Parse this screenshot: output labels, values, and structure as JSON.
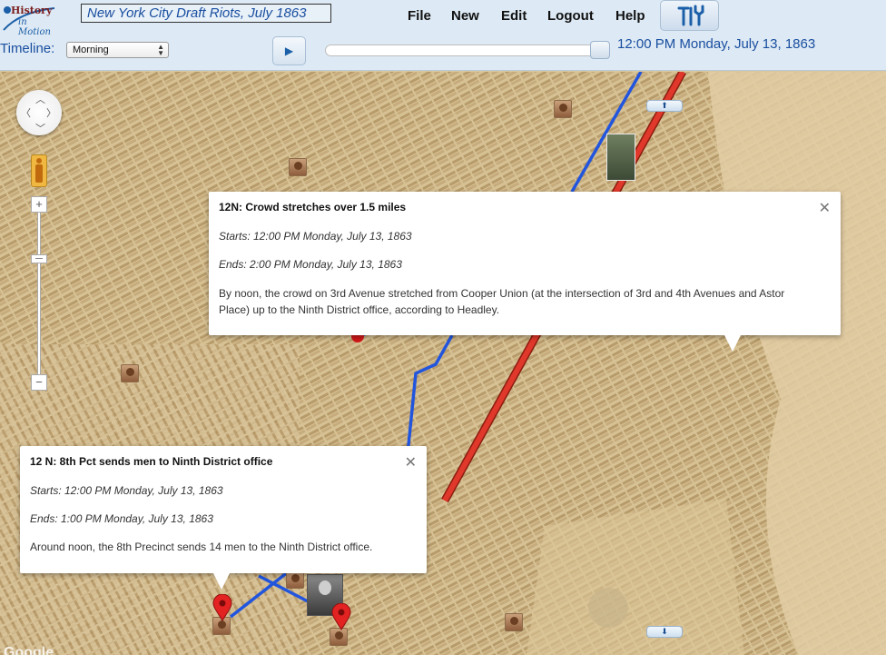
{
  "app": {
    "logo_top": "History",
    "logo_bottom": "in Motion",
    "document_title": "New York City Draft Riots, July 1863"
  },
  "menu": [
    {
      "label": "File"
    },
    {
      "label": "New"
    },
    {
      "label": "Edit"
    },
    {
      "label": "Logout"
    },
    {
      "label": "Help"
    }
  ],
  "toolbar": {
    "tools_icon": "tools-icon",
    "timeline_label": "Timeline:",
    "timeline_selected": "Morning",
    "play_icon": "play-icon",
    "play_glyph": "▶",
    "current_time": "12:00 PM Monday, July 13, 1863"
  },
  "map": {
    "nav_up_glyph": "⬆",
    "nav_down_glyph": "⬇",
    "zoom_in": "+",
    "zoom_out": "−",
    "attribution": "Google",
    "route_colors": {
      "blue": "#2255dd",
      "red": "#e0382a"
    }
  },
  "info_windows": [
    {
      "title": "12N: Crowd stretches over 1.5 miles",
      "start": "Starts: 12:00 PM Monday, July 13, 1863",
      "end": "Ends: 2:00 PM Monday, July 13, 1863",
      "body": "By noon, the crowd on 3rd Avenue stretched from Cooper Union (at the intersection of 3rd and 4th Avenues and Astor Place) up to the Ninth District office, according to Headley."
    },
    {
      "title": "12 N: 8th Pct sends men to Ninth District office",
      "start": "Starts: 12:00 PM Monday, July 13, 1863",
      "end": "Ends: 1:00 PM Monday, July 13, 1863",
      "body": "Around noon, the 8th Precinct sends 14 men to the Ninth District office."
    }
  ]
}
